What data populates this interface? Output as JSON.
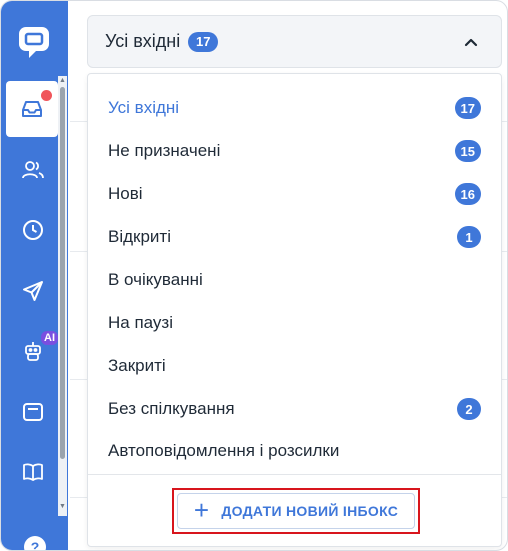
{
  "colors": {
    "sidebar": "#3f77d9",
    "accent": "#3f77d9",
    "notification_dot": "#f0555b",
    "ai_badge": "#7a4fe0",
    "highlight_border": "#d8151d"
  },
  "sidebar": {
    "logo_icon": "chat-bubble-icon",
    "items": [
      {
        "name": "inbox",
        "icon": "inbox-icon",
        "active": true,
        "has_notification": true
      },
      {
        "name": "contacts",
        "icon": "users-icon"
      },
      {
        "name": "history",
        "icon": "clock-icon"
      },
      {
        "name": "campaigns",
        "icon": "send-icon"
      },
      {
        "name": "ai-bot",
        "icon": "robot-icon",
        "badge": "AI"
      },
      {
        "name": "wallet",
        "icon": "wallet-icon"
      },
      {
        "name": "knowledge-base",
        "icon": "book-icon"
      }
    ],
    "help_icon": "help-icon"
  },
  "header": {
    "title": "Усі вхідні",
    "count": "17"
  },
  "dropdown": {
    "items": [
      {
        "label": "Усі вхідні",
        "count": "17",
        "selected": true
      },
      {
        "label": "Не призначені",
        "count": "15"
      },
      {
        "label": "Нові",
        "count": "16"
      },
      {
        "label": "Відкриті",
        "count": "1"
      },
      {
        "label": "В очікуванні",
        "count": ""
      },
      {
        "label": "На паузі",
        "count": ""
      },
      {
        "label": "Закриті",
        "count": ""
      },
      {
        "label": "Без спілкування",
        "count": "2"
      },
      {
        "label": "Автоповідомлення і розсилки",
        "count": ""
      }
    ],
    "add_button": {
      "plus": "+",
      "label": "ДОДАТИ НОВИЙ ІНБОКС"
    }
  }
}
